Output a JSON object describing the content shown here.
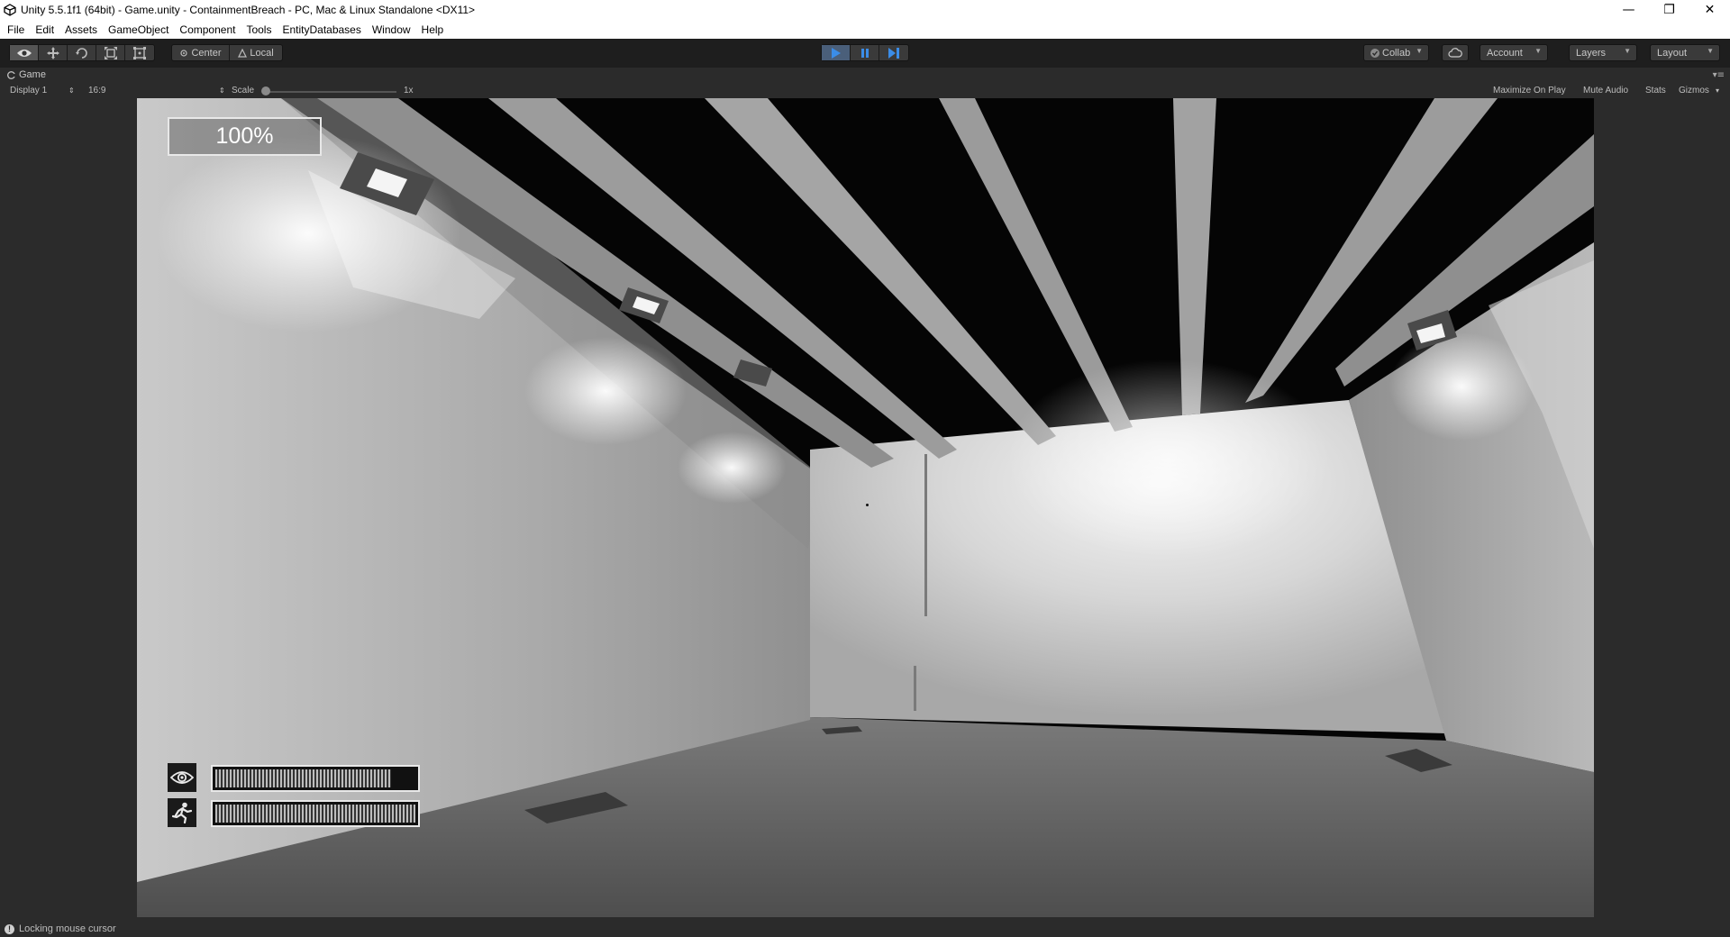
{
  "window": {
    "title": "Unity 5.5.1f1 (64bit) - Game.unity - ContainmentBreach - PC, Mac & Linux Standalone <DX11>",
    "minimize": "—",
    "restore": "❐",
    "close": "✕"
  },
  "menu": [
    "File",
    "Edit",
    "Assets",
    "GameObject",
    "Component",
    "Tools",
    "EntityDatabases",
    "Window",
    "Help"
  ],
  "toolbar": {
    "pivot_label": "Center",
    "space_label": "Local",
    "collab_label": "Collab",
    "account_label": "Account",
    "layers_label": "Layers",
    "layout_label": "Layout",
    "play_state": "playing"
  },
  "game_tab": {
    "tab_label": "Game",
    "display_label": "Display 1",
    "aspect_label": "16:9",
    "scale_label": "Scale",
    "scale_value": "1x",
    "maximize_on_play": "Maximize On Play",
    "mute_audio": "Mute Audio",
    "stats": "Stats",
    "gizmos": "Gizmos"
  },
  "hud": {
    "health_percent_text": "100%",
    "blink_meter_fraction": 0.88,
    "stamina_meter_fraction": 1.0
  },
  "status": {
    "message": "Locking mouse cursor"
  },
  "colors": {
    "unity_dark": "#2b2b2b",
    "toolbar": "#1e1e1e",
    "play_active": "#4a5f7a",
    "play_icon": "#3b8de8"
  }
}
